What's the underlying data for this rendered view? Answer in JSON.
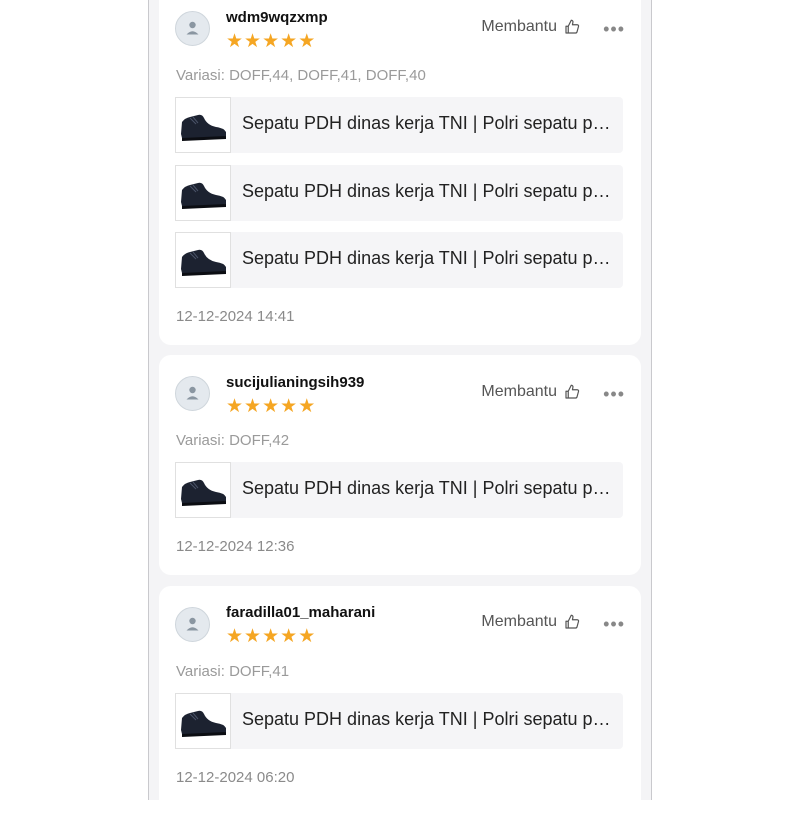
{
  "helpful_label": "Membantu",
  "more_label": "•••",
  "accent_star_color": "#f5a623",
  "icons": {
    "avatar": "user-avatar-icon",
    "helpful": "thumbs-up-icon",
    "product": "shoe-thumbnail-icon",
    "more": "more-dots-icon"
  },
  "reviews": [
    {
      "username": "wdm9wqzxmp",
      "rating": 5,
      "variation": "Variasi: DOFF,44, DOFF,41, DOFF,40",
      "products": [
        "Sepatu PDH dinas kerja TNI | Polri sepatu pantofel",
        "Sepatu PDH dinas kerja TNI | Polri sepatu pantofel",
        "Sepatu PDH dinas kerja TNI | Polri sepatu pantofel"
      ],
      "date": "12-12-2024 14:41"
    },
    {
      "username": "sucijulianingsih939",
      "rating": 5,
      "variation": "Variasi: DOFF,42",
      "products": [
        "Sepatu PDH dinas kerja TNI | Polri sepatu pantofel"
      ],
      "date": "12-12-2024 12:36"
    },
    {
      "username": "faradilla01_maharani",
      "rating": 5,
      "variation": "Variasi: DOFF,41",
      "products": [
        "Sepatu PDH dinas kerja TNI | Polri sepatu pantofel"
      ],
      "date": "12-12-2024 06:20"
    }
  ]
}
